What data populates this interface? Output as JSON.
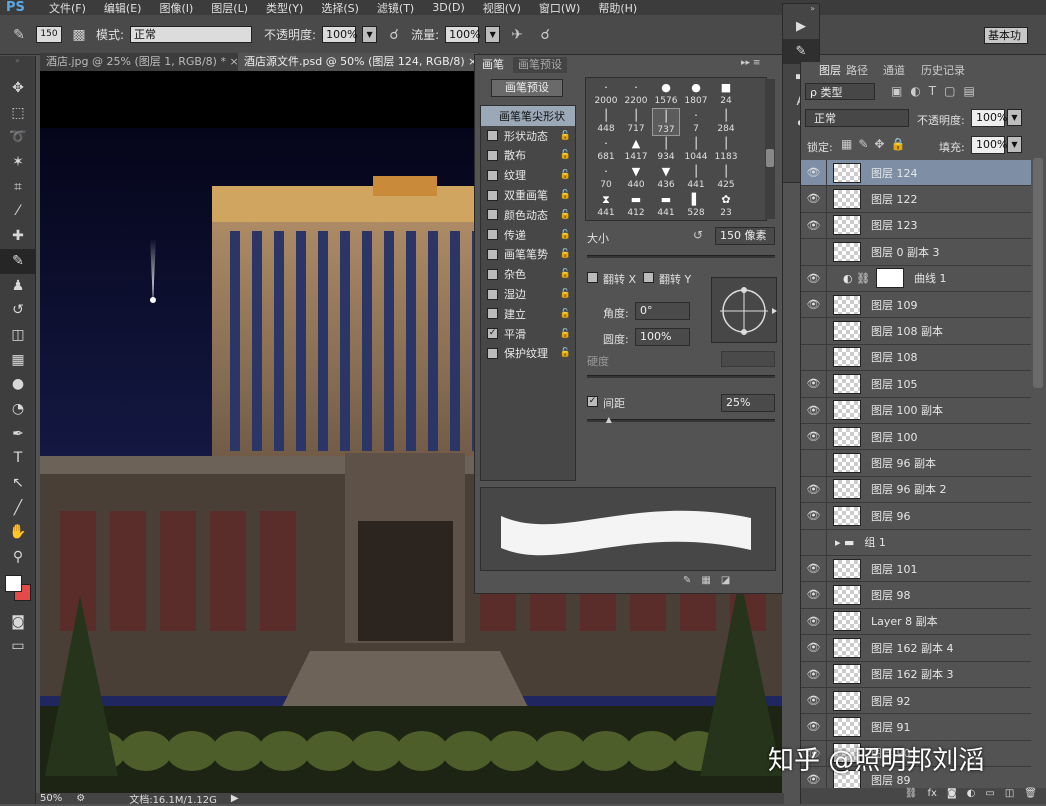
{
  "app": {
    "logo": "PS"
  },
  "menu": [
    "文件(F)",
    "编辑(E)",
    "图像(I)",
    "图层(L)",
    "类型(Y)",
    "选择(S)",
    "滤镜(T)",
    "3D(D)",
    "视图(V)",
    "窗口(W)",
    "帮助(H)"
  ],
  "options": {
    "size": "150",
    "mode_label": "模式:",
    "mode_value": "正常",
    "opacity_label": "不透明度:",
    "opacity_value": "100%",
    "flow_label": "流量:",
    "flow_value": "100%",
    "workspace": "基本功"
  },
  "doc_tabs": [
    {
      "label": "酒店.jpg @ 25% (图层 1, RGB/8) *",
      "close": "×"
    },
    {
      "label": "酒店源文件.psd @ 50% (图层 124, RGB/8)",
      "close": "×"
    }
  ],
  "toolbar_icons": [
    "move-icon",
    "marquee-icon",
    "lasso-icon",
    "magic-wand-icon",
    "crop-icon",
    "eyedropper-icon",
    "healing-icon",
    "brush-icon",
    "stamp-icon",
    "history-brush-icon",
    "eraser-icon",
    "gradient-icon",
    "blur-icon",
    "dodge-icon",
    "pen-icon",
    "type-icon",
    "path-select-icon",
    "line-icon",
    "hand-icon",
    "zoom-icon"
  ],
  "toolbar_glyphs": [
    "✥",
    "⬚",
    "➰",
    "✶",
    "⌗",
    "⁄",
    "✚",
    "✎",
    "♟",
    "↺",
    "◫",
    "▦",
    "●",
    "◔",
    "✒",
    "T",
    "↖",
    "╱",
    "✋",
    "⚲"
  ],
  "colors": {
    "foreground": "#ffffff",
    "background": "#e34a4a",
    "selected_layer": "#7d8ea5",
    "sky_top": "#05051a",
    "sky_bottom": "#232b6b"
  },
  "brush_panel": {
    "tabs": [
      "画笔",
      "画笔预设"
    ],
    "preset_button": "画笔预设",
    "tip_shape": "画笔笔尖形状",
    "options": [
      {
        "label": "形状动态",
        "checked": false
      },
      {
        "label": "散布",
        "checked": false
      },
      {
        "label": "纹理",
        "checked": false
      },
      {
        "label": "双重画笔",
        "checked": false
      },
      {
        "label": "颜色动态",
        "checked": false
      },
      {
        "label": "传递",
        "checked": false
      },
      {
        "label": "画笔笔势",
        "checked": false
      },
      {
        "label": "杂色",
        "checked": false
      },
      {
        "label": "湿边",
        "checked": false
      },
      {
        "label": "建立",
        "checked": false
      },
      {
        "label": "平滑",
        "checked": true
      },
      {
        "label": "保护纹理",
        "checked": false
      }
    ],
    "presets": [
      "2000",
      "2200",
      "1576",
      "1807",
      "24",
      "448",
      "717",
      "737",
      "7",
      "284",
      "681",
      "1417",
      "934",
      "1044",
      "1183",
      "70",
      "440",
      "436",
      "441",
      "425",
      "441",
      "412",
      "441",
      "528",
      "23"
    ],
    "size_label": "大小",
    "size_value": "150 像素",
    "size_fraction": 0.42,
    "flip_x": "翻转 X",
    "flip_y": "翻转 Y",
    "angle_label": "角度:",
    "angle_value": "0°",
    "roundness_label": "圆度:",
    "roundness_value": "100%",
    "hardness_label": "硬度",
    "spacing_label": "间距",
    "spacing_checked": true,
    "spacing_value": "25%",
    "spacing_fraction": 0.1
  },
  "layers_panel": {
    "tabs": [
      "图层",
      "路径",
      "通道",
      "历史记录"
    ],
    "kind_label": "类型",
    "blend_mode": "正常",
    "opacity_label": "不透明度:",
    "opacity_value": "100%",
    "lock_label": "锁定:",
    "fill_label": "填充:",
    "fill_value": "100%",
    "layers": [
      {
        "name": "图层 124",
        "visible": true,
        "selected": true
      },
      {
        "name": "图层 122",
        "visible": true
      },
      {
        "name": "图层 123",
        "visible": true
      },
      {
        "name": "图层 0 副本 3",
        "visible": false
      },
      {
        "name": "曲线 1",
        "visible": true,
        "adjustment": true
      },
      {
        "name": "图层 109",
        "visible": true
      },
      {
        "name": "图层 108 副本",
        "visible": false
      },
      {
        "name": "图层 108",
        "visible": false
      },
      {
        "name": "图层 105",
        "visible": true
      },
      {
        "name": "图层 100 副本",
        "visible": true
      },
      {
        "name": "图层 100",
        "visible": true
      },
      {
        "name": "图层 96 副本",
        "visible": false
      },
      {
        "name": "图层 96 副本 2",
        "visible": true
      },
      {
        "name": "图层 96",
        "visible": true
      },
      {
        "name": "组 1",
        "visible": false,
        "group": true
      },
      {
        "name": "图层 101",
        "visible": true
      },
      {
        "name": "图层 98",
        "visible": true
      },
      {
        "name": "Layer 8 副本",
        "visible": true
      },
      {
        "name": "图层 162 副本 4",
        "visible": true
      },
      {
        "name": "图层 162 副本 3",
        "visible": true
      },
      {
        "name": "图层 92",
        "visible": true
      },
      {
        "name": "图层 91",
        "visible": true
      },
      {
        "name": "图层 90",
        "visible": true
      },
      {
        "name": "图层 89",
        "visible": true
      }
    ],
    "footer_icons": [
      "link-icon",
      "fx-icon",
      "mask-icon",
      "adjustment-icon",
      "folder-icon",
      "new-layer-icon",
      "trash-icon"
    ],
    "footer_glyphs": [
      "⛓",
      "fx",
      "◙",
      "◐",
      "▭",
      "◫",
      "🗑"
    ]
  },
  "status": {
    "zoom": "50%",
    "doc": "文档:16.1M/1.12G"
  },
  "watermark": "知乎 @照明邦刘滔"
}
